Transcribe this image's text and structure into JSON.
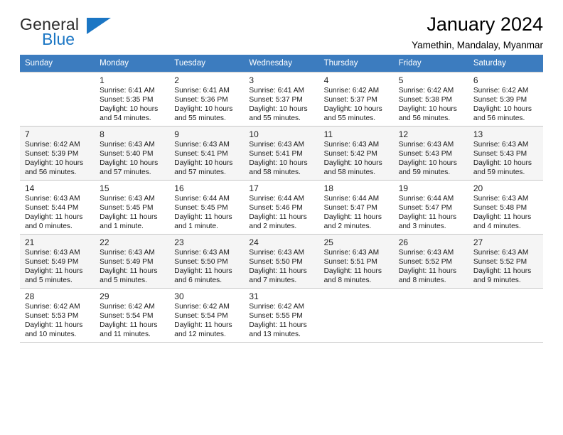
{
  "brand": {
    "name_top": "General",
    "name_bottom": "Blue",
    "color_primary": "#1b76c4",
    "color_text": "#2b2b2b"
  },
  "header": {
    "title": "January 2024",
    "subtitle": "Yamethin, Mandalay, Myanmar"
  },
  "calendar": {
    "header_bg": "#3c7cbf",
    "header_text_color": "#ffffff",
    "weekdays": [
      "Sunday",
      "Monday",
      "Tuesday",
      "Wednesday",
      "Thursday",
      "Friday",
      "Saturday"
    ],
    "weeks": [
      [
        {
          "day": "",
          "info": ""
        },
        {
          "day": "1",
          "info": "Sunrise: 6:41 AM\nSunset: 5:35 PM\nDaylight: 10 hours and 54 minutes."
        },
        {
          "day": "2",
          "info": "Sunrise: 6:41 AM\nSunset: 5:36 PM\nDaylight: 10 hours and 55 minutes."
        },
        {
          "day": "3",
          "info": "Sunrise: 6:41 AM\nSunset: 5:37 PM\nDaylight: 10 hours and 55 minutes."
        },
        {
          "day": "4",
          "info": "Sunrise: 6:42 AM\nSunset: 5:37 PM\nDaylight: 10 hours and 55 minutes."
        },
        {
          "day": "5",
          "info": "Sunrise: 6:42 AM\nSunset: 5:38 PM\nDaylight: 10 hours and 56 minutes."
        },
        {
          "day": "6",
          "info": "Sunrise: 6:42 AM\nSunset: 5:39 PM\nDaylight: 10 hours and 56 minutes."
        }
      ],
      [
        {
          "day": "7",
          "info": "Sunrise: 6:42 AM\nSunset: 5:39 PM\nDaylight: 10 hours and 56 minutes."
        },
        {
          "day": "8",
          "info": "Sunrise: 6:43 AM\nSunset: 5:40 PM\nDaylight: 10 hours and 57 minutes."
        },
        {
          "day": "9",
          "info": "Sunrise: 6:43 AM\nSunset: 5:41 PM\nDaylight: 10 hours and 57 minutes."
        },
        {
          "day": "10",
          "info": "Sunrise: 6:43 AM\nSunset: 5:41 PM\nDaylight: 10 hours and 58 minutes."
        },
        {
          "day": "11",
          "info": "Sunrise: 6:43 AM\nSunset: 5:42 PM\nDaylight: 10 hours and 58 minutes."
        },
        {
          "day": "12",
          "info": "Sunrise: 6:43 AM\nSunset: 5:43 PM\nDaylight: 10 hours and 59 minutes."
        },
        {
          "day": "13",
          "info": "Sunrise: 6:43 AM\nSunset: 5:43 PM\nDaylight: 10 hours and 59 minutes."
        }
      ],
      [
        {
          "day": "14",
          "info": "Sunrise: 6:43 AM\nSunset: 5:44 PM\nDaylight: 11 hours and 0 minutes."
        },
        {
          "day": "15",
          "info": "Sunrise: 6:43 AM\nSunset: 5:45 PM\nDaylight: 11 hours and 1 minute."
        },
        {
          "day": "16",
          "info": "Sunrise: 6:44 AM\nSunset: 5:45 PM\nDaylight: 11 hours and 1 minute."
        },
        {
          "day": "17",
          "info": "Sunrise: 6:44 AM\nSunset: 5:46 PM\nDaylight: 11 hours and 2 minutes."
        },
        {
          "day": "18",
          "info": "Sunrise: 6:44 AM\nSunset: 5:47 PM\nDaylight: 11 hours and 2 minutes."
        },
        {
          "day": "19",
          "info": "Sunrise: 6:44 AM\nSunset: 5:47 PM\nDaylight: 11 hours and 3 minutes."
        },
        {
          "day": "20",
          "info": "Sunrise: 6:43 AM\nSunset: 5:48 PM\nDaylight: 11 hours and 4 minutes."
        }
      ],
      [
        {
          "day": "21",
          "info": "Sunrise: 6:43 AM\nSunset: 5:49 PM\nDaylight: 11 hours and 5 minutes."
        },
        {
          "day": "22",
          "info": "Sunrise: 6:43 AM\nSunset: 5:49 PM\nDaylight: 11 hours and 5 minutes."
        },
        {
          "day": "23",
          "info": "Sunrise: 6:43 AM\nSunset: 5:50 PM\nDaylight: 11 hours and 6 minutes."
        },
        {
          "day": "24",
          "info": "Sunrise: 6:43 AM\nSunset: 5:50 PM\nDaylight: 11 hours and 7 minutes."
        },
        {
          "day": "25",
          "info": "Sunrise: 6:43 AM\nSunset: 5:51 PM\nDaylight: 11 hours and 8 minutes."
        },
        {
          "day": "26",
          "info": "Sunrise: 6:43 AM\nSunset: 5:52 PM\nDaylight: 11 hours and 8 minutes."
        },
        {
          "day": "27",
          "info": "Sunrise: 6:43 AM\nSunset: 5:52 PM\nDaylight: 11 hours and 9 minutes."
        }
      ],
      [
        {
          "day": "28",
          "info": "Sunrise: 6:42 AM\nSunset: 5:53 PM\nDaylight: 11 hours and 10 minutes."
        },
        {
          "day": "29",
          "info": "Sunrise: 6:42 AM\nSunset: 5:54 PM\nDaylight: 11 hours and 11 minutes."
        },
        {
          "day": "30",
          "info": "Sunrise: 6:42 AM\nSunset: 5:54 PM\nDaylight: 11 hours and 12 minutes."
        },
        {
          "day": "31",
          "info": "Sunrise: 6:42 AM\nSunset: 5:55 PM\nDaylight: 11 hours and 13 minutes."
        },
        {
          "day": "",
          "info": ""
        },
        {
          "day": "",
          "info": ""
        },
        {
          "day": "",
          "info": ""
        }
      ]
    ]
  }
}
